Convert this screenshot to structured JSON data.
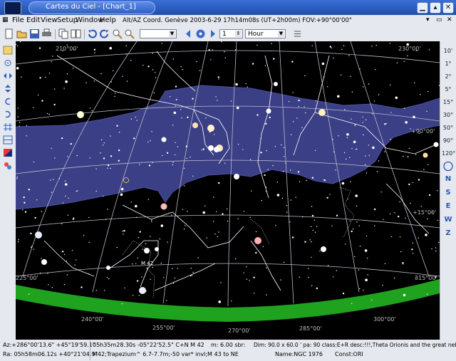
{
  "window": {
    "title": "Cartes du Ciel - [Chart_1]"
  },
  "menu": [
    "File",
    "Edit",
    "View",
    "Setup",
    "Window",
    "Help"
  ],
  "chart_info": "Alt/AZ Coord. Genève 2003-6-29 17h14m08s (UT+2h00m) FOV:+90°00'00\"",
  "toolbar": {
    "step_value": "1",
    "step_unit": "Hour",
    "projection_value": ""
  },
  "fov_buttons": [
    "10'",
    "1°",
    "2°",
    "5°",
    "15°",
    "30°",
    "50°",
    "90°",
    "120°"
  ],
  "direction_buttons": [
    "N",
    "S",
    "E",
    "W",
    "Z"
  ],
  "azimuth_labels": [
    "210°00'",
    "225°00'",
    "240°00'",
    "255°00'",
    "270°00'",
    "285°00'",
    "300°00'",
    "230°00'",
    "+90°00'",
    "+15°00'",
    "315°00'"
  ],
  "object_label": "M 42",
  "status": {
    "azalt_line1": "Az:+286°00'13.6\" +45°19'59.1\"",
    "azalt_line2": "Ra: 05h58m06.12s +40°21'04.9\"",
    "obj_line1": "05h35m28.30s -05°22'52.5\" C+N M  42",
    "obj_line2": "M42;Trapezium^ 6.7-7.7m;-50 var* invl;M 43 to NE",
    "mag": "m: 6.00 sbr:",
    "dim": "Dim: 90.0 x 60.0 ' pa: 90 class:E+R desc:!!!,Theta Orionis and the great nebula",
    "name": "Name:NGC 1976",
    "const": "Const:ORI"
  },
  "colors": {
    "sky": "#000000",
    "milkyway": "#3b3f86",
    "horizon": "#1fa31f",
    "grid": "#b9b9c8",
    "titlebar": "#2a5cc0"
  }
}
